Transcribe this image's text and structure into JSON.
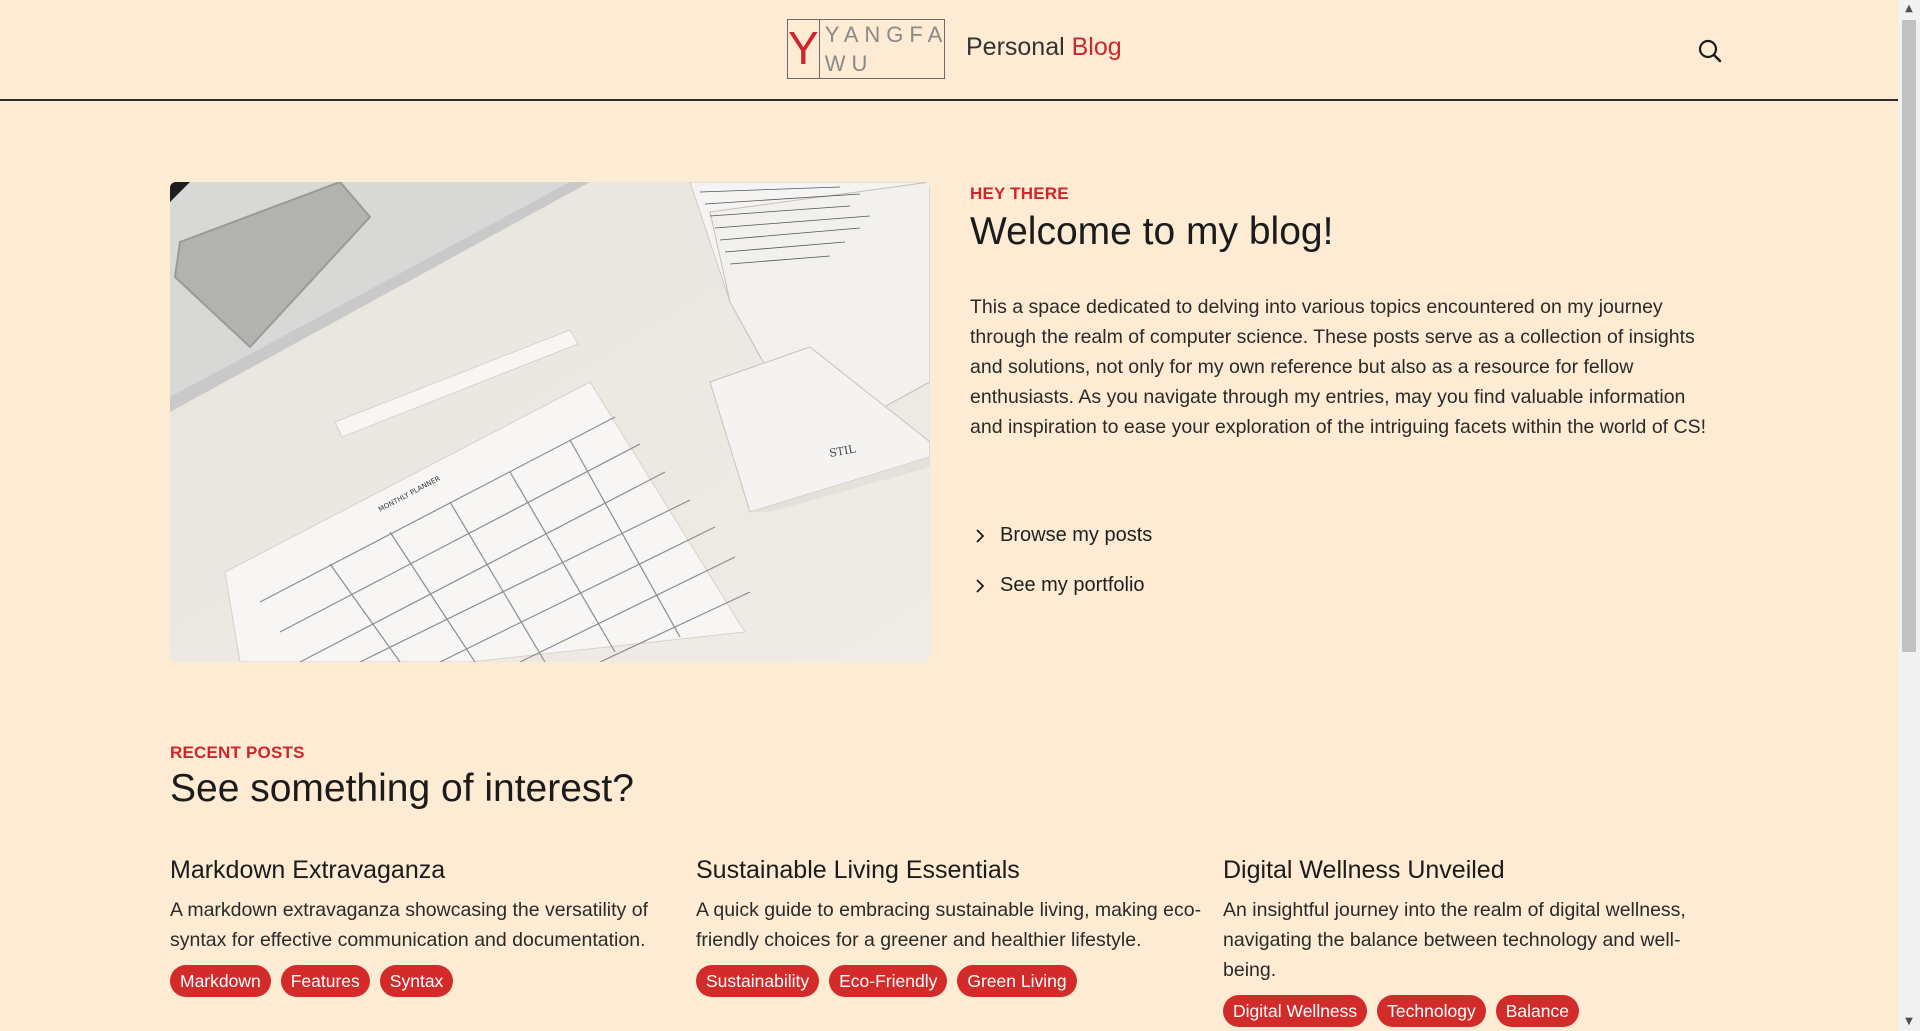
{
  "header": {
    "logo_letter": "Y",
    "logo_line1": "YANGFA",
    "logo_line2": "WU",
    "site_title_prefix": "Personal",
    "site_title_accent": "Blog",
    "search_icon": "search-icon"
  },
  "hero": {
    "eyebrow": "HEY THERE",
    "heading": "Welcome to my blog!",
    "body": "This a space dedicated to delving into various topics encountered on my journey through the realm of computer science. These posts serve as a collection of insights and solutions, not only for my own reference but also as a resource for fellow enthusiasts. As you navigate through my entries, may you find valuable information and inspiration to ease your exploration of the intriguing facets within the world of CS!",
    "links": [
      {
        "label": "Browse my posts",
        "icon": "chevron-right-icon"
      },
      {
        "label": "See my portfolio",
        "icon": "chevron-right-icon"
      }
    ],
    "image_labels": [
      "MONTHLY PLANNER",
      "STIL"
    ]
  },
  "recent": {
    "eyebrow": "RECENT POSTS",
    "heading": "See something of interest?",
    "posts": [
      {
        "title": "Markdown Extravaganza",
        "description": "A markdown extravaganza showcasing the versatility of syntax for effective communication and documentation.",
        "tags": [
          "Markdown",
          "Features",
          "Syntax"
        ]
      },
      {
        "title": "Sustainable Living Essentials",
        "description": "A quick guide to embracing sustainable living, making eco-friendly choices for a greener and healthier lifestyle.",
        "tags": [
          "Sustainability",
          "Eco-Friendly",
          "Green Living"
        ]
      },
      {
        "title": "Digital Wellness Unveiled",
        "description": "An insightful journey into the realm of digital wellness, navigating the balance between technology and well-being.",
        "tags": [
          "Digital Wellness",
          "Technology",
          "Balance"
        ]
      }
    ]
  },
  "colors": {
    "background": "#fdebd3",
    "accent": "#d0262b",
    "tag_bg": "#d32a2a"
  }
}
